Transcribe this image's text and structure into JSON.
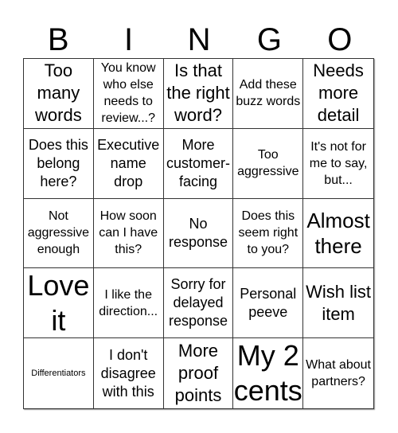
{
  "header": [
    "B",
    "I",
    "N",
    "G",
    "O"
  ],
  "cells": [
    {
      "text": "Too many words",
      "size": "l"
    },
    {
      "text": "You know who else needs to review...?",
      "size": "s"
    },
    {
      "text": "Is that the right word?",
      "size": "l"
    },
    {
      "text": "Add these buzz words",
      "size": "s"
    },
    {
      "text": "Needs more detail",
      "size": "l"
    },
    {
      "text": "Does this belong here?",
      "size": "m"
    },
    {
      "text": "Executive name drop",
      "size": "m"
    },
    {
      "text": "More customer-facing",
      "size": "m"
    },
    {
      "text": "Too aggressive",
      "size": "s"
    },
    {
      "text": "It's not for me to say, but...",
      "size": "s"
    },
    {
      "text": "Not aggressive enough",
      "size": "s"
    },
    {
      "text": "How soon can I have this?",
      "size": "s"
    },
    {
      "text": "No response",
      "size": "m"
    },
    {
      "text": "Does this seem right to you?",
      "size": "s"
    },
    {
      "text": "Almost there",
      "size": "xl"
    },
    {
      "text": "Love it",
      "size": "xxl"
    },
    {
      "text": "I like the direction...",
      "size": "s"
    },
    {
      "text": "Sorry for delayed response",
      "size": "m"
    },
    {
      "text": "Personal peeve",
      "size": "m"
    },
    {
      "text": "Wish list item",
      "size": "l"
    },
    {
      "text": "Differentiators",
      "size": "xs"
    },
    {
      "text": "I don't disagree with this",
      "size": "m"
    },
    {
      "text": "More proof points",
      "size": "l"
    },
    {
      "text": "My 2 cents",
      "size": "xxl"
    },
    {
      "text": "What about partners?",
      "size": "s"
    }
  ]
}
